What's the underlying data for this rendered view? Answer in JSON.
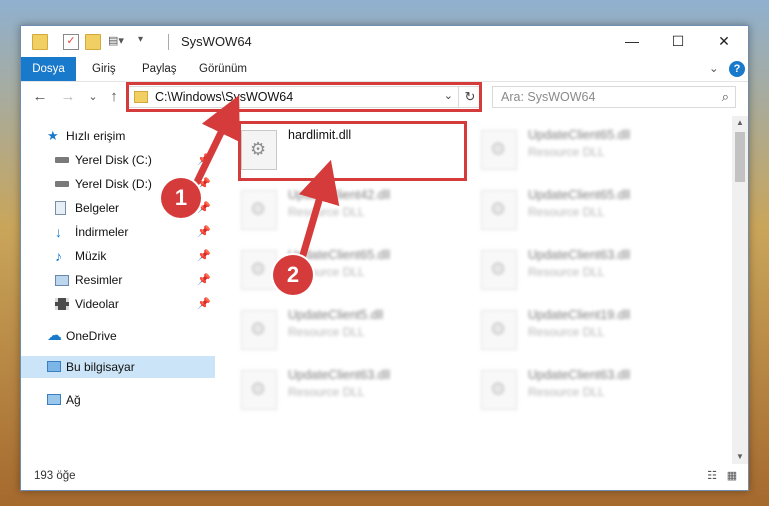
{
  "window": {
    "title": "SysWOW64"
  },
  "titlebar": {
    "minimize": "—",
    "maximize": "☐",
    "close": "✕"
  },
  "ribbon": {
    "tabs": [
      "Dosya",
      "Giriş",
      "Paylaş",
      "Görünüm"
    ],
    "expand": "⌄",
    "help": "?"
  },
  "nav": {
    "back": "←",
    "forward": "→",
    "recent": "⌄",
    "up": "↑"
  },
  "address": {
    "path": "C:\\Windows\\SysWOW64",
    "dropdown": "⌄",
    "refresh": "↻"
  },
  "search": {
    "placeholder": "Ara: SysWOW64",
    "icon": "⌕"
  },
  "sidebar": {
    "items": [
      {
        "label": "Hızlı erişim",
        "icon": "star-icon"
      },
      {
        "label": "Yerel Disk (C:)",
        "icon": "drive-icon",
        "pin": "📌"
      },
      {
        "label": "Yerel Disk (D:)",
        "icon": "drive-icon",
        "pin": "📌"
      },
      {
        "label": "Belgeler",
        "icon": "documents-icon",
        "pin": "📌"
      },
      {
        "label": "İndirmeler",
        "icon": "download-icon",
        "pin": "📌"
      },
      {
        "label": "Müzik",
        "icon": "music-icon",
        "pin": "📌"
      },
      {
        "label": "Resimler",
        "icon": "pictures-icon",
        "pin": "📌"
      },
      {
        "label": "Videolar",
        "icon": "videos-icon",
        "pin": "📌"
      },
      {
        "label": "OneDrive",
        "icon": "cloud-icon"
      },
      {
        "label": "Bu bilgisayar",
        "icon": "computer-icon"
      },
      {
        "label": "Ağ",
        "icon": "network-icon"
      }
    ]
  },
  "files": [
    {
      "name": "hardlimit.dll",
      "type": ""
    },
    {
      "name": "UpdateClient65.dll",
      "type": "Resource DLL"
    },
    {
      "name": "UpdateClient42.dll",
      "type": "Resource DLL"
    },
    {
      "name": "UpdateClient65.dll",
      "type": "Resource DLL"
    },
    {
      "name": "UpdateClient65.dll",
      "type": "Resource DLL"
    },
    {
      "name": "UpdateClient63.dll",
      "type": "Resource DLL"
    },
    {
      "name": "UpdateClient5.dll",
      "type": "Resource DLL"
    },
    {
      "name": "UpdateClient19.dll",
      "type": "Resource DLL"
    },
    {
      "name": "UpdateClient63.dll",
      "type": "Resource DLL"
    },
    {
      "name": "UpdateClient63.dll",
      "type": "Resource DLL"
    }
  ],
  "status": {
    "count": "193 öğe"
  },
  "annotations": {
    "step1": "1",
    "step2": "2",
    "color": "#d63b3b"
  },
  "colors": {
    "accent": "#1979ca",
    "selected": "#cce4f7"
  }
}
